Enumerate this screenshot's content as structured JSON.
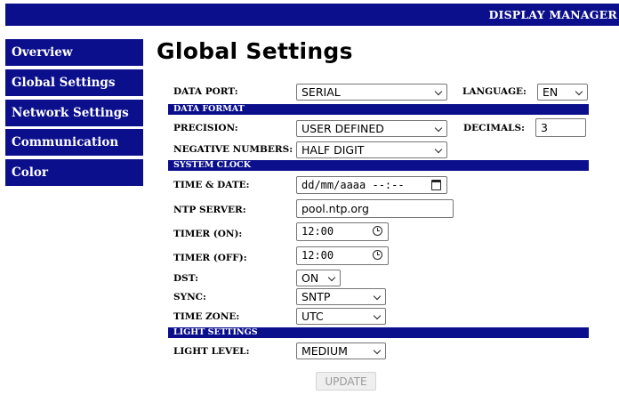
{
  "header": {
    "title": "DISPLAY MANAGER"
  },
  "sidebar": {
    "items": [
      {
        "label": "Overview"
      },
      {
        "label": "Global Settings"
      },
      {
        "label": "Network Settings"
      },
      {
        "label": "Communication"
      },
      {
        "label": "Color"
      }
    ]
  },
  "page": {
    "title": "Global Settings"
  },
  "form": {
    "data_port": {
      "label": "DATA PORT:",
      "value": "SERIAL"
    },
    "language": {
      "label": "LANGUAGE:",
      "value": "EN"
    },
    "section_data_format": "DATA FORMAT",
    "precision": {
      "label": "PRECISION:",
      "value": "USER DEFINED"
    },
    "decimals": {
      "label": "DECIMALS:",
      "value": "3"
    },
    "negative_numbers": {
      "label": "NEGATIVE NUMBERS:",
      "value": "HALF DIGIT"
    },
    "section_system_clock": "SYSTEM CLOCK",
    "time_date": {
      "label": "TIME & DATE:",
      "value": "dd/mm/aaaa --:--"
    },
    "ntp_server": {
      "label": "NTP SERVER:",
      "value": "pool.ntp.org"
    },
    "timer_on": {
      "label": "TIMER (ON):",
      "value": "12:00"
    },
    "timer_off": {
      "label": "TIMER (OFF):",
      "value": "12:00"
    },
    "dst": {
      "label": "DST:",
      "value": "ON"
    },
    "sync": {
      "label": "SYNC:",
      "value": "SNTP"
    },
    "time_zone": {
      "label": "TIME ZONE:",
      "value": "UTC"
    },
    "section_light_settings": "LIGHT SETTINGS",
    "light_level": {
      "label": "LIGHT LEVEL:",
      "value": "MEDIUM"
    },
    "update_label": "UPDATE"
  }
}
